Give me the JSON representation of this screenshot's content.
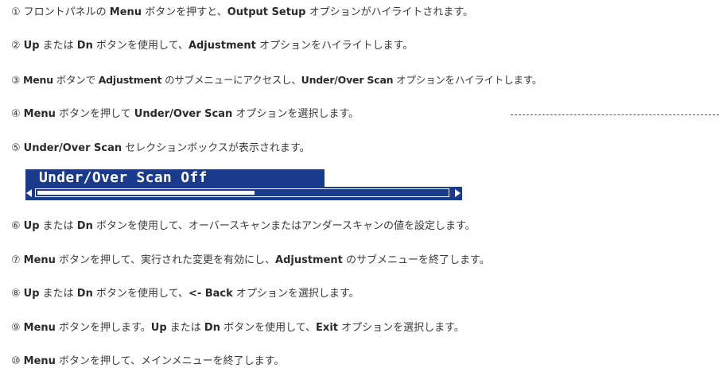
{
  "steps": [
    {
      "num": "①",
      "parts": [
        {
          "t": "フロントパネルの "
        },
        {
          "t": "Menu",
          "b": true
        },
        {
          "t": " ボタンを押すと、"
        },
        {
          "t": "Output Setup",
          "b": true
        },
        {
          "t": " オプションがハイライトされます。"
        }
      ]
    },
    {
      "num": "②",
      "parts": [
        {
          "t": "Up",
          "b": true
        },
        {
          "t": " または "
        },
        {
          "t": "Dn",
          "b": true
        },
        {
          "t": " ボタンを使用して、"
        },
        {
          "t": "Adjustment",
          "b": true
        },
        {
          "t": " オプションをハイライトします。"
        }
      ]
    },
    {
      "num": "③",
      "parts": [
        {
          "t": "Menu",
          "b": true
        },
        {
          "t": " ボタンで "
        },
        {
          "t": "Adjustment",
          "b": true
        },
        {
          "t": " のサブメニューにアクセスし、"
        },
        {
          "t": "Under/Over Scan",
          "b": true
        },
        {
          "t": " オプションをハイライトします。"
        }
      ]
    },
    {
      "num": "④",
      "parts": [
        {
          "t": "Menu",
          "b": true
        },
        {
          "t": " ボタンを押して "
        },
        {
          "t": "Under/Over Scan",
          "b": true
        },
        {
          "t": " オプションを選択します。"
        }
      ]
    },
    {
      "num": "⑤",
      "parts": [
        {
          "t": "Under/Over Scan",
          "b": true
        },
        {
          "t": " セレクションボックスが表示されます。"
        }
      ]
    },
    {
      "num": "⑥",
      "parts": [
        {
          "t": "Up",
          "b": true
        },
        {
          "t": " または "
        },
        {
          "t": "Dn",
          "b": true
        },
        {
          "t": " ボタンを使用して、オーバースキャンまたはアンダースキャンの値を設定します。"
        }
      ]
    },
    {
      "num": "⑦",
      "parts": [
        {
          "t": "Menu",
          "b": true
        },
        {
          "t": " ボタンを押して、実行された変更を有効にし、"
        },
        {
          "t": "Adjustment",
          "b": true
        },
        {
          "t": " のサブメニューを終了します。"
        }
      ]
    },
    {
      "num": "⑧",
      "parts": [
        {
          "t": "Up",
          "b": true
        },
        {
          "t": " または "
        },
        {
          "t": "Dn",
          "b": true
        },
        {
          "t": " ボタンを使用して、"
        },
        {
          "t": "<- Back",
          "b": true
        },
        {
          "t": " オプションを選択します。"
        }
      ]
    },
    {
      "num": "⑨",
      "parts": [
        {
          "t": "Menu",
          "b": true
        },
        {
          "t": " ボタンを押します。"
        },
        {
          "t": "Up",
          "b": true
        },
        {
          "t": " または "
        },
        {
          "t": "Dn",
          "b": true
        },
        {
          "t": " ボタンを使用して、"
        },
        {
          "t": "Exit",
          "b": true
        },
        {
          "t": " オプションを選択します。"
        }
      ]
    },
    {
      "num": "⑩",
      "parts": [
        {
          "t": "Menu",
          "b": true
        },
        {
          "t": " ボタンを押して、メインメニューを終了します。"
        }
      ]
    }
  ],
  "osd": {
    "title": "Under/Over Scan Off",
    "level": 0.53,
    "colors": {
      "background": "#1a3a8c",
      "foreground": "#ffffff"
    },
    "left_icon": "arrow-left-icon",
    "right_icon": "arrow-right-icon"
  }
}
